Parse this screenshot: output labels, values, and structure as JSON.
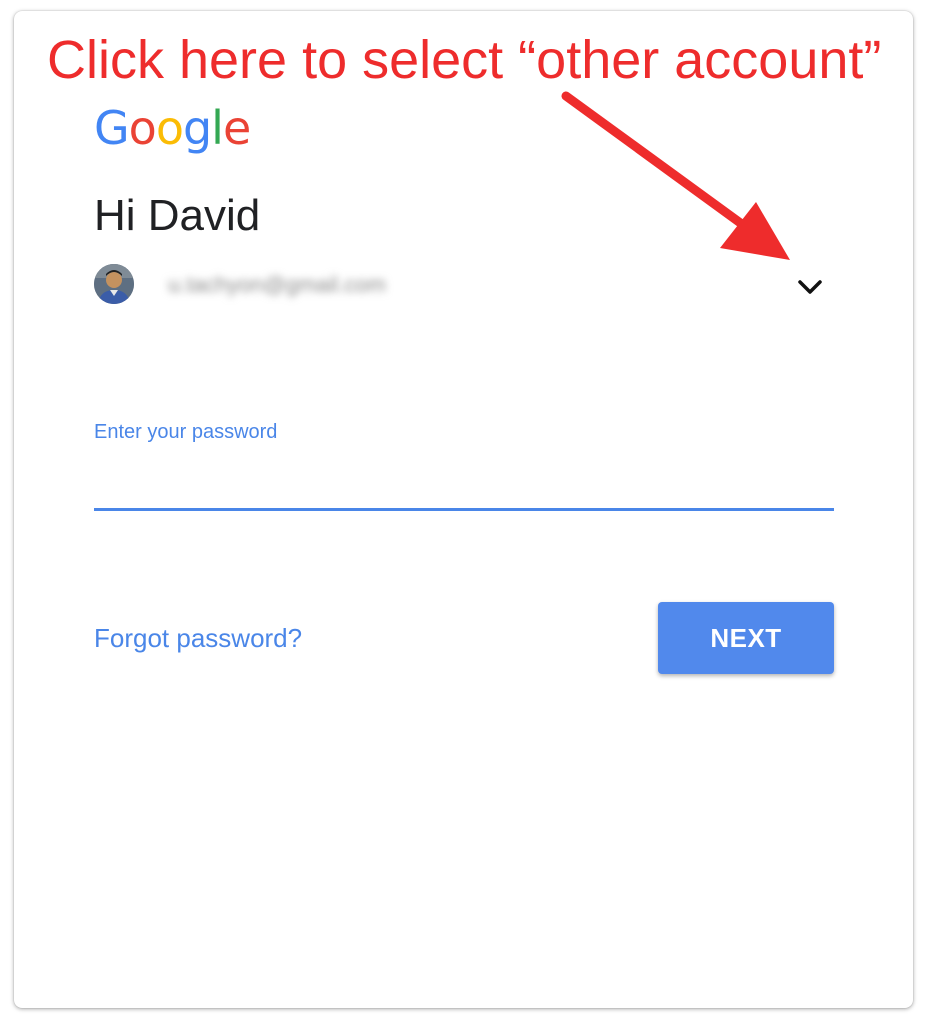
{
  "annotation": {
    "text": "Click here to select “other account”",
    "color": "#ee2c2c"
  },
  "logo": {
    "letters": [
      {
        "char": "G",
        "color": "#4285f4"
      },
      {
        "char": "o",
        "color": "#ea4335"
      },
      {
        "char": "o",
        "color": "#fbbc05"
      },
      {
        "char": "g",
        "color": "#4285f4"
      },
      {
        "char": "l",
        "color": "#34a853"
      },
      {
        "char": "e",
        "color": "#ea4335"
      }
    ]
  },
  "greeting": "Hi David",
  "account": {
    "email": "u.tachyon@gmail.com",
    "avatar_icon": "user-avatar",
    "switch_icon": "chevron-down-icon"
  },
  "password": {
    "label": "Enter your password",
    "value": "",
    "accent_color": "#4a86e8"
  },
  "actions": {
    "forgot_label": "Forgot password?",
    "next_label": "NEXT",
    "next_color": "#5189ec"
  }
}
